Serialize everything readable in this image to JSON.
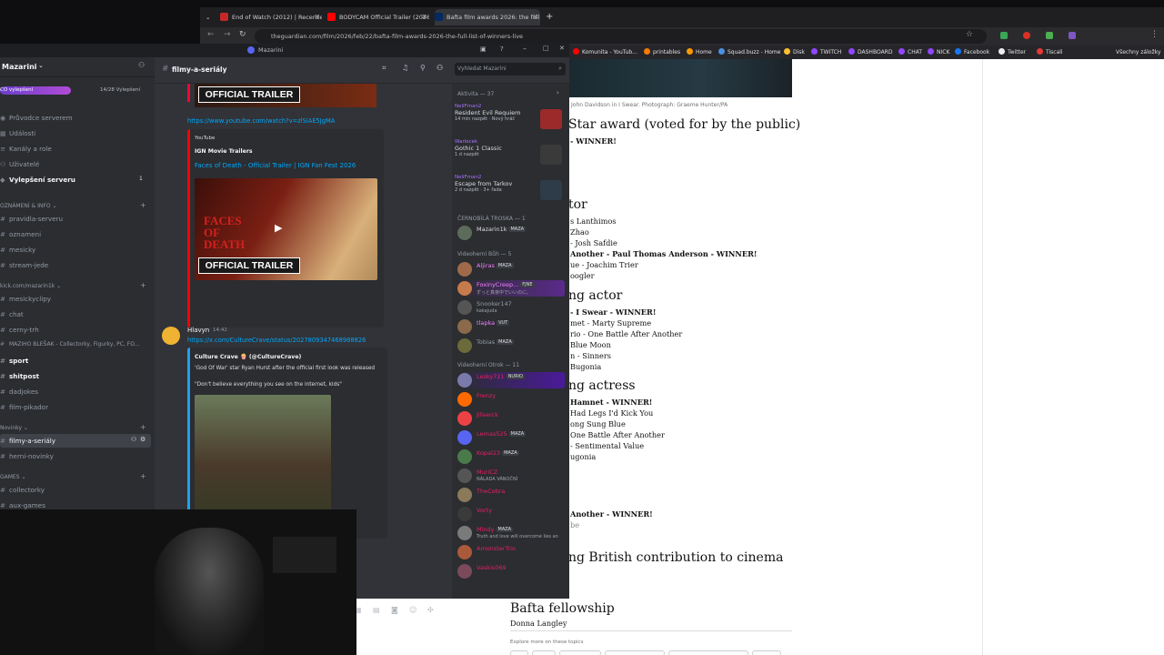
{
  "browser": {
    "tabs": [
      {
        "label": "End of Watch (2012) | Recenze",
        "favcolor": "#c62828"
      },
      {
        "label": "BODYCAM Official Trailer (2026)",
        "favcolor": "#ff0000"
      },
      {
        "label": "Bafta film awards 2026: the full",
        "favcolor": "#052962"
      }
    ],
    "new_tab": "+",
    "url": "theguardian.com/film/2026/feb/22/bafta-film-awards-2026-the-full-list-of-winners-live",
    "bookmarks": [
      "Komunita - YouTub...",
      "printables",
      "Home",
      "Squad.buzz - Home",
      "Disk",
      "TWITCH",
      "DASHBOARD",
      "CHAT",
      "NICK",
      "Facebook",
      "Twitter",
      "Tiscali",
      "Všechny záložky"
    ]
  },
  "article": {
    "caption": "John Davidson in I Swear. Photograph: Graeme Hunter/PA",
    "sections": [
      {
        "heading": "Star award (voted for by the public)",
        "lines": [
          {
            "t": "- WINNER!",
            "b": true
          }
        ]
      },
      {
        "heading": "tor",
        "lines": [
          {
            "t": "s Lanthimos",
            "b": false
          },
          {
            "t": "Zhao",
            "b": false
          },
          {
            "t": "- Josh Safdie",
            "b": false
          },
          {
            "t": "Another - Paul Thomas Anderson - WINNER!",
            "b": true
          },
          {
            "t": "ue - Joachim Trier",
            "b": false
          },
          {
            "t": "oogler",
            "b": false
          }
        ]
      },
      {
        "heading": "ng actor",
        "lines": [
          {
            "t": "- I Swear - WINNER!",
            "b": true
          },
          {
            "t": "met - Marty Supreme",
            "b": false
          },
          {
            "t": "rio - One Battle After Another",
            "b": false
          },
          {
            "t": "Blue Moon",
            "b": false
          },
          {
            "t": "n - Sinners",
            "b": false
          },
          {
            "t": "Bugonia",
            "b": false
          }
        ]
      },
      {
        "heading": "ng actress",
        "lines": [
          {
            "t": "Hamnet - WINNER!",
            "b": true
          },
          {
            "t": "Had Legs I'd Kick You",
            "b": false
          },
          {
            "t": "ong Sung Blue",
            "b": false
          },
          {
            "t": "One Battle After Another",
            "b": false
          },
          {
            "t": "- Sentimental Value",
            "b": false
          },
          {
            "t": "ugonia",
            "b": false
          }
        ]
      }
    ],
    "extra_line": "Another - WINNER!",
    "extra_line2": "be",
    "british_heading": "ng British contribution to cinema",
    "fellowship_heading": "Bafta fellowship",
    "fellowship_name": "Donna Langley",
    "explore": "Explore more on these topics"
  },
  "discord": {
    "window_title": "Mazarini",
    "server_name": "Mazarini",
    "boost_label": "CO vylepšení",
    "boost_count": "14/28 Vylepšení",
    "nav": [
      "Průvodce serverem",
      "Události",
      "Kanály a role",
      "Uživatelé",
      "Vylepšení serveru"
    ],
    "boost_badge": "1",
    "categories": {
      "announce": "OZNÁMENÍ & INFO",
      "kick": "kick.com/mazarin1k",
      "novinky": "Novinky",
      "games": "GAMES"
    },
    "channels_a": [
      "pravidla-serveru",
      "oznameni",
      "mesicky",
      "stream-jede"
    ],
    "channels_b": [
      "mesickyclipy",
      "chat",
      "cerny-trh",
      "MAZIHO BLEŠAK - Collectorky, Figurky, PC, FO...",
      "sport",
      "shitpost",
      "dadjokes",
      "film-pikador"
    ],
    "channels_c": [
      "filmy-a-seriály",
      "herni-novinky"
    ],
    "channels_d": [
      "collectorky",
      "aux-games"
    ],
    "current_channel": "filmy-a-seriály",
    "search_placeholder": "Vyhledat Mazarini",
    "chat": {
      "trailer_label": "OFFICIAL TRAILER",
      "yt_link": "https://www.youtube.com/watch?v=zlSiAE5JgMA",
      "embed_site": "YouTube",
      "embed_author": "IGN Movie Trailers",
      "embed_title": "Faces of Death - Official Trailer | IGN Fan Fest 2026",
      "thumb_text": "FACES OF DEATH",
      "msg_author": "Hlavyn",
      "msg_time": "14:42",
      "msg_link": "https://x.com/CultureCrave/status/2027809347468988826",
      "tweet_author": "Culture Crave 🍿 (@CultureCrave)",
      "tweet_text1": "'God Of War' star Ryan Hurst after the official first look was released",
      "tweet_text2": "\"Don't believe everything you see on the internet, kids\""
    },
    "members": {
      "activity_header": "Aktivita — 37",
      "activities": [
        {
          "name": "NeliFman2",
          "game": "Resident Evil Requiem",
          "time": "14 min nazpět · Nový hráč",
          "color": "#9c2a2a"
        },
        {
          "name": "Warlecek",
          "game": "Gothic 1 Classic",
          "time": "1 d nazpět",
          "color": "#3a3a3a"
        },
        {
          "name": "NeliFman2",
          "game": "Escape from Tarkov",
          "time": "2 d nazpět · 3+ řada",
          "color": "#2e3b48"
        }
      ],
      "group1": "ČERNOBÍLÁ TROSKA — 1",
      "g1": [
        {
          "name": "Mazarin1k",
          "tag": "MAZA",
          "color": "#dbdee1",
          "status": ""
        }
      ],
      "group2": "Videoherní Bůh — 5",
      "g2": [
        {
          "name": "Aljiras",
          "tag": "MAZA",
          "color": "#f47fff",
          "status": ""
        },
        {
          "name": "FoxinyCreep...",
          "tag": "FJNE",
          "color": "#f47fff",
          "status": "ずっと真夜中でいいのに。"
        },
        {
          "name": "Snooker147",
          "tag": "",
          "color": "#949ba4",
          "status": "kakajuda"
        },
        {
          "name": "tlapka",
          "tag": "VUT",
          "color": "#f47fff",
          "status": ""
        },
        {
          "name": "Tobias",
          "tag": "MAZA",
          "color": "#949ba4",
          "status": ""
        }
      ],
      "group3": "Videoherní Otrok — 11",
      "g3": [
        {
          "name": "Lesky721",
          "tag": "NURIO",
          "color": "#e91e63",
          "status": ""
        },
        {
          "name": "Frenzy",
          "tag": "",
          "color": "#e91e63",
          "status": ""
        },
        {
          "name": "Jifeerck",
          "tag": "",
          "color": "#e91e63",
          "status": ""
        },
        {
          "name": "Lemas525",
          "tag": "MAZA",
          "color": "#e91e63",
          "status": ""
        },
        {
          "name": "Kopal23",
          "tag": "MAZA",
          "color": "#e91e63",
          "status": ""
        },
        {
          "name": "MuriCZ",
          "tag": "",
          "color": "#e91e63",
          "status": "NÁLADA VÁNOČNÍ"
        },
        {
          "name": "TheCobra",
          "tag": "",
          "color": "#e91e63",
          "status": ""
        },
        {
          "name": "Vorty",
          "tag": "",
          "color": "#e91e63",
          "status": ""
        },
        {
          "name": "Mindy",
          "tag": "MAZA",
          "color": "#e91e63",
          "status": "Truth and love will overcome lies an"
        },
        {
          "name": "AmonsterTrio",
          "tag": "",
          "color": "#e91e63",
          "status": ""
        },
        {
          "name": "Vaskis069",
          "tag": "",
          "color": "#e91e63",
          "status": ""
        }
      ]
    }
  },
  "colors": {
    "accent": "#5865f2",
    "link": "#00a8fc",
    "discord_bg": "#313338"
  }
}
